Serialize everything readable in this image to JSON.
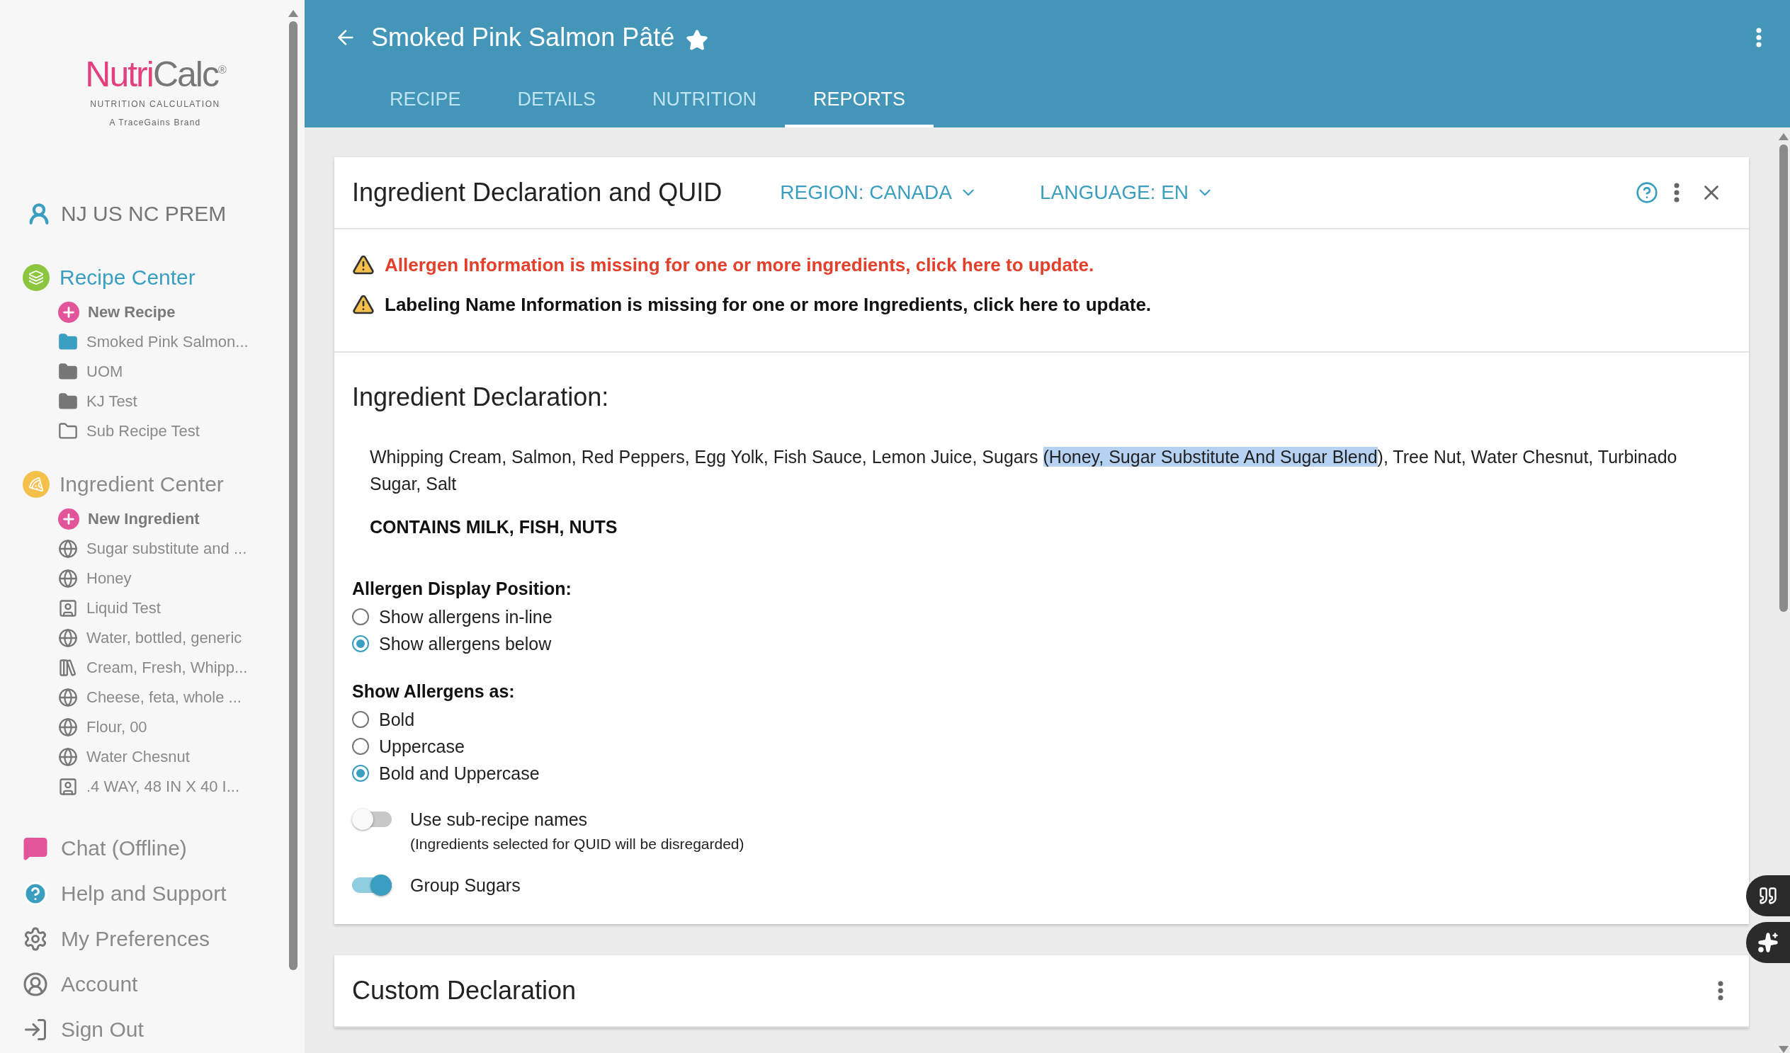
{
  "sidebar": {
    "logo": {
      "part1": "Nutri",
      "part2": "Calc",
      "mark": "®",
      "tagline": "NUTRITION CALCULATION",
      "brand": "A TraceGains Brand"
    },
    "user": "NJ US NC PREM",
    "sections": [
      {
        "title": "Recipe Center",
        "kind": "recipe",
        "active": true,
        "color": "#8cc63f",
        "new_label": "New Recipe",
        "items": [
          {
            "label": "Smoked Pink Salmon...",
            "kind": "folder",
            "selected": true
          },
          {
            "label": "UOM",
            "kind": "folder",
            "selected": false
          },
          {
            "label": "KJ Test",
            "kind": "folder",
            "selected": false
          },
          {
            "label": "Sub Recipe Test",
            "kind": "outline",
            "selected": false
          }
        ]
      },
      {
        "title": "Ingredient Center",
        "kind": "ingredient",
        "active": false,
        "color": "#f5c04a",
        "new_label": "New Ingredient",
        "items": [
          {
            "label": "Sugar substitute and ...",
            "kind": "global",
            "selected": false
          },
          {
            "label": "Honey",
            "kind": "global",
            "selected": false
          },
          {
            "label": "Liquid Test",
            "kind": "user",
            "selected": false
          },
          {
            "label": "Water, bottled, generic",
            "kind": "global",
            "selected": false
          },
          {
            "label": "Cream, Fresh, Whipp...",
            "kind": "combined",
            "selected": false
          },
          {
            "label": "Cheese, feta, whole ...",
            "kind": "global",
            "selected": false
          },
          {
            "label": "Flour, 00",
            "kind": "global",
            "selected": false
          },
          {
            "label": "Water Chesnut",
            "kind": "global",
            "selected": false
          },
          {
            "label": ".4 WAY, 48 IN X 40 I...",
            "kind": "user",
            "selected": false
          }
        ]
      }
    ],
    "links": [
      {
        "label": "Chat (Offline)",
        "kind": "chat"
      },
      {
        "label": "Help and Support",
        "kind": "help"
      },
      {
        "label": "My Preferences",
        "kind": "preferences"
      },
      {
        "label": "Account",
        "kind": "account"
      },
      {
        "label": "Sign Out",
        "kind": "signout"
      }
    ]
  },
  "header": {
    "title": "Smoked Pink Salmon Pâté",
    "favorite": true,
    "tabs": [
      {
        "label": "RECIPE",
        "selected": false
      },
      {
        "label": "DETAILS",
        "selected": false
      },
      {
        "label": "NUTRITION",
        "selected": false
      },
      {
        "label": "REPORTS",
        "selected": true
      }
    ]
  },
  "report_card": {
    "title": "Ingredient Declaration and QUID",
    "region": "REGION: CANADA",
    "language": "LANGUAGE: EN",
    "alerts": [
      {
        "text": "Allergen Information is missing for one or more ingredients, click here to update.",
        "kind": "error"
      },
      {
        "text": "Labeling Name Information is missing for one or more Ingredients, click here to update.",
        "kind": "warning"
      }
    ],
    "declaration_heading": "Ingredient Declaration:",
    "declaration": [
      {
        "text": "Whipping Cream, Salmon, Red Peppers, Egg Yolk, Fish Sauce, Lemon Juice, Sugars ",
        "highlighted": false
      },
      {
        "text": "(Honey, Sugar Substitute And Sugar Blend",
        "highlighted": true
      },
      {
        "text": "), Tree Nut, Water Chesnut, Turbinado Sugar, Salt",
        "highlighted": false
      }
    ],
    "contains": "CONTAINS MILK, FISH, NUTS",
    "option_groups": [
      {
        "label": "Allergen Display Position:",
        "options": [
          {
            "label": "Show allergens in-line",
            "selected": false
          },
          {
            "label": "Show allergens below",
            "selected": true
          }
        ]
      },
      {
        "label": "Show Allergens as:",
        "options": [
          {
            "label": "Bold",
            "selected": false
          },
          {
            "label": "Uppercase",
            "selected": false
          },
          {
            "label": "Bold and Uppercase",
            "selected": true
          }
        ]
      }
    ],
    "toggles": [
      {
        "label": "Use sub-recipe names",
        "note": "(Ingredients selected for QUID will be disregarded)",
        "on": false
      },
      {
        "label": "Group Sugars",
        "on": true
      }
    ]
  },
  "custom_card": {
    "title": "Custom Declaration"
  }
}
